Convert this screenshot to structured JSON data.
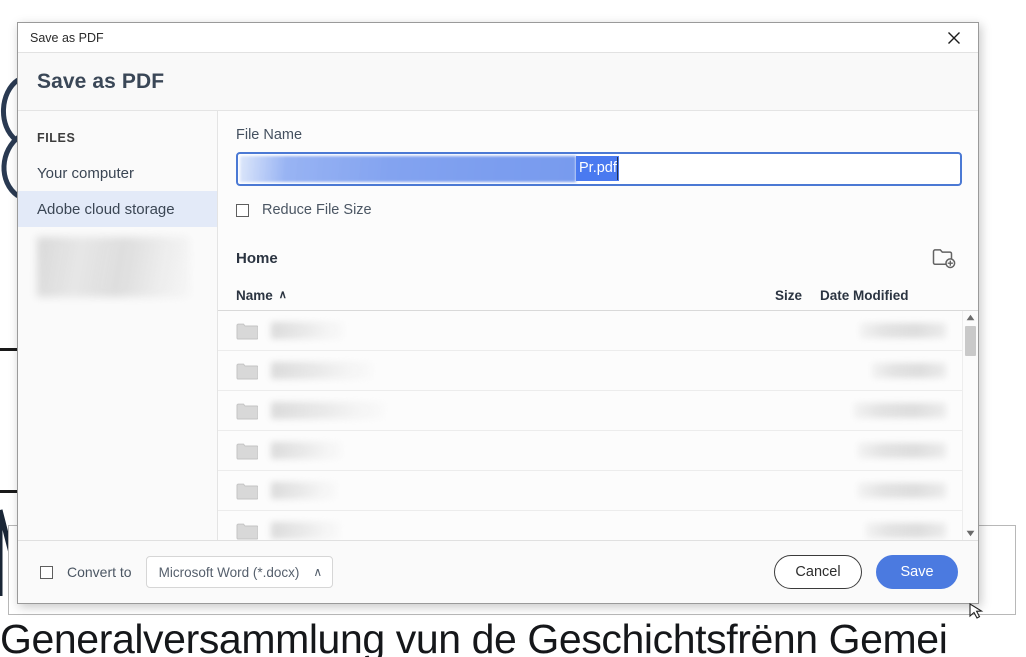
{
  "background": {
    "glyph_fragments": "N",
    "heading": "Generalversammlung vun de Geschichtsfrënn Gemei"
  },
  "dialog": {
    "titlebar": {
      "title": "Save as PDF",
      "close_icon": "close-icon"
    },
    "heading": "Save as PDF",
    "sidebar": {
      "section_label": "FILES",
      "items": [
        {
          "label": "Your computer",
          "selected": false
        },
        {
          "label": "Adobe cloud storage",
          "selected": true
        }
      ]
    },
    "filename": {
      "label": "File Name",
      "visible_text": "Pr.pdf",
      "selection_color": "#4a7af0",
      "border_color": "#4b79d4"
    },
    "reduce_file_size": {
      "label": "Reduce File Size",
      "checked": false
    },
    "location": {
      "label": "Home",
      "new_folder_icon": "new-folder-icon"
    },
    "table": {
      "columns": {
        "name": "Name",
        "sort_caret": "∧",
        "size": "Size",
        "date_modified": "Date Modified"
      },
      "rows": [
        {
          "icon": "folder-icon",
          "name": "",
          "name_width": 74,
          "size": "",
          "date": "",
          "date_width": 86
        },
        {
          "icon": "folder-icon",
          "name": "",
          "name_width": 102,
          "size": "",
          "date": "",
          "date_width": 74
        },
        {
          "icon": "folder-icon",
          "name": "",
          "name_width": 114,
          "size": "",
          "date": "",
          "date_width": 92
        },
        {
          "icon": "folder-icon",
          "name": "",
          "name_width": 72,
          "size": "",
          "date": "",
          "date_width": 88
        },
        {
          "icon": "folder-icon",
          "name": "",
          "name_width": 66,
          "size": "",
          "date": "",
          "date_width": 88
        },
        {
          "icon": "folder-icon",
          "name": "",
          "name_width": 70,
          "size": "",
          "date": "",
          "date_width": 80
        }
      ],
      "scrollbar": {
        "up_arrow": "▲",
        "down_arrow": "▼"
      }
    },
    "footer": {
      "convert_to_label": "Convert to",
      "convert_to_checked": false,
      "convert_to_value": "Microsoft Word (*.docx)",
      "convert_to_caret": "∧",
      "cancel_label": "Cancel",
      "save_label": "Save",
      "save_color": "#4b7ae0"
    }
  }
}
